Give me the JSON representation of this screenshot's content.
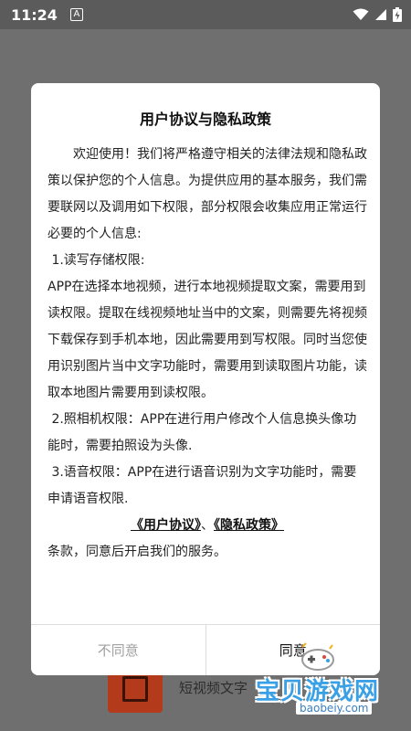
{
  "status_bar": {
    "time": "11:24",
    "notification_letter": "A",
    "icons": [
      "wifi-icon",
      "signal-icon",
      "battery-icon"
    ]
  },
  "background_app": {
    "label": "短视频文字",
    "accent": "#b33a1b"
  },
  "dialog": {
    "title": "用户协议与隐私政策",
    "intro": "欢迎使用！我们将严格遵守相关的法律法规和隐私政策以保护您的个人信息。为提供应用的基本服务，我们需要联网以及调用如下权限，部分权限会收集应用正常运行必要的个人信息:",
    "perm1_title": "1.读写存储权限:",
    "perm1_body": "APP在选择本地视频，进行本地视频提取文案，需要用到读权限。提取在线视频地址当中的文案，则需要先将视频下载保存到手机本地，因此需要用到写权限。同时当您使用识别图片当中文字功能时，需要用到读取图片功能，读取本地图片需要用到读权限。",
    "perm2": "2.照相机权限：APP在进行用户修改个人信息换头像功能时，需要拍照设为头像.",
    "perm3": "3.语音权限：APP在进行语音识别为文字功能时，需要申请语音权限.",
    "link_user_agreement": "《用户协议》",
    "link_separator": "、",
    "link_privacy_policy": "《隐私政策》",
    "closing": "条款，同意后开启我们的服务。",
    "disagree_label": "不同意",
    "agree_label": "同意"
  },
  "watermark": {
    "text": "宝贝游戏网",
    "url": "baobeiy.com"
  }
}
